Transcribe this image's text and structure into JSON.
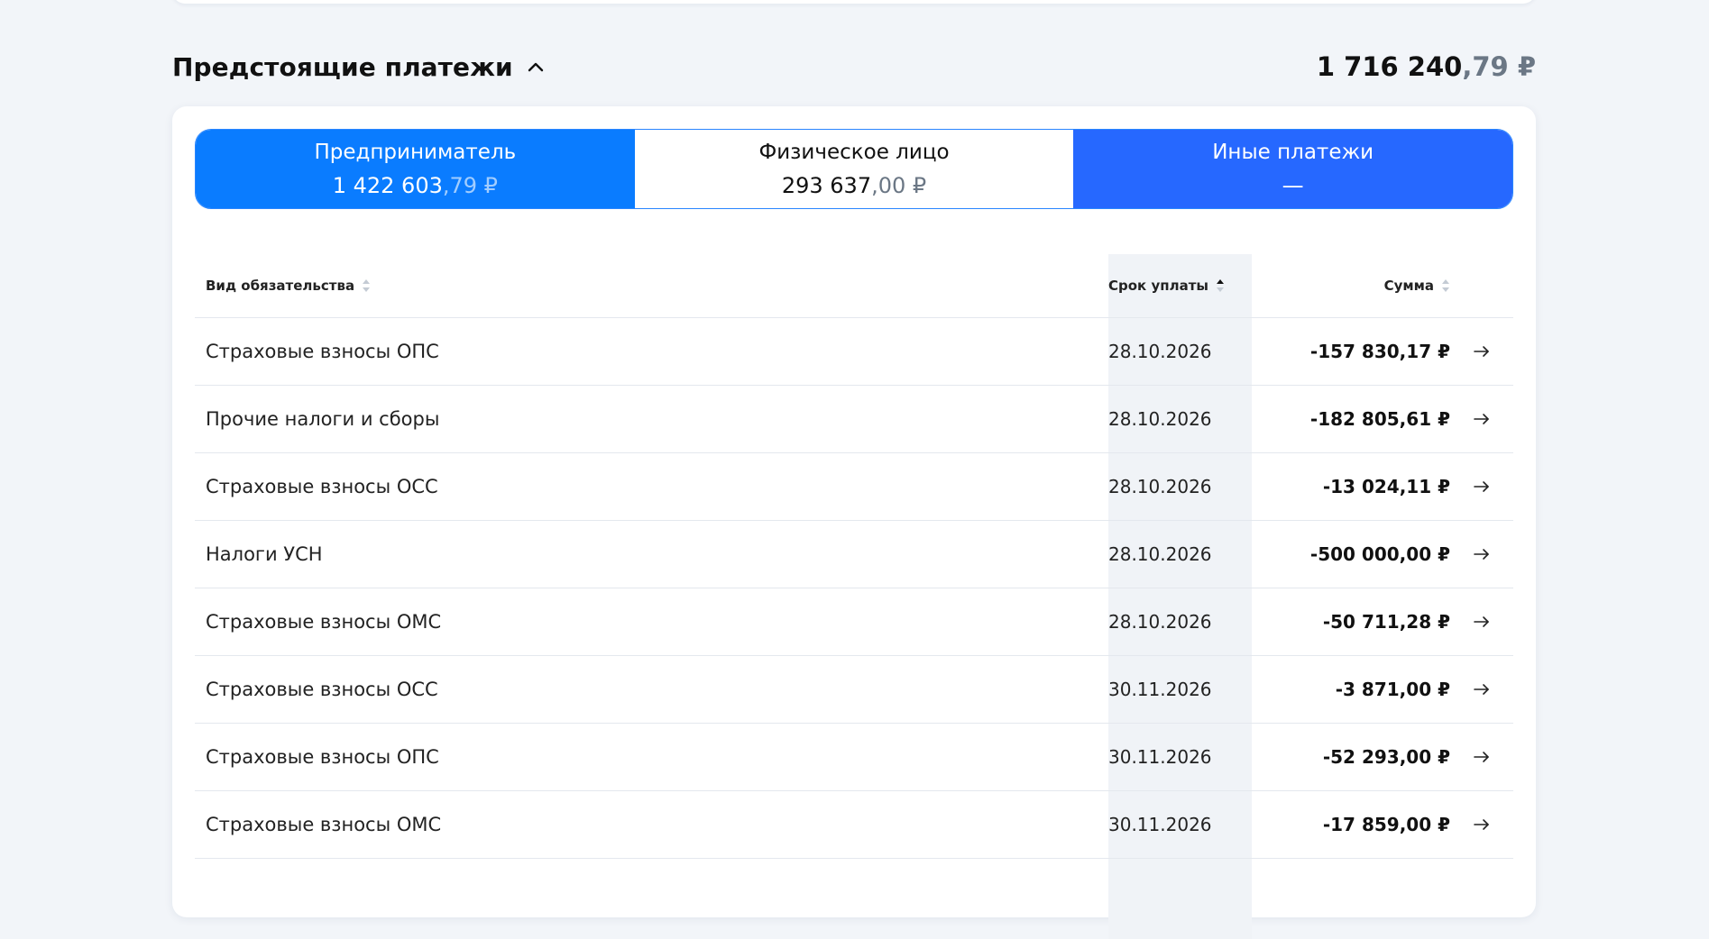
{
  "section": {
    "title": "Предстоящие платежи",
    "total_int": "1 716 240",
    "total_frac": ",79 ₽"
  },
  "tabs": [
    {
      "label": "Предприниматель",
      "amount_int": "1 422 603",
      "amount_frac": ",79 ₽"
    },
    {
      "label": "Физическое лицо",
      "amount_int": "293 637",
      "amount_frac": ",00 ₽"
    },
    {
      "label": "Иные платежи",
      "amount_int": "—",
      "amount_frac": ""
    }
  ],
  "table": {
    "headers": {
      "type": "Вид обязательства",
      "date": "Срок уплаты",
      "sum": "Сумма"
    },
    "rows": [
      {
        "type": "Страховые взносы ОПС",
        "date": "28.10.2026",
        "sum": "-157 830,17 ₽"
      },
      {
        "type": "Прочие налоги и сборы",
        "date": "28.10.2026",
        "sum": "-182 805,61 ₽"
      },
      {
        "type": "Страховые взносы ОСС",
        "date": "28.10.2026",
        "sum": "-13 024,11 ₽"
      },
      {
        "type": "Налоги УСН",
        "date": "28.10.2026",
        "sum": "-500 000,00 ₽"
      },
      {
        "type": "Страховые взносы ОМС",
        "date": "28.10.2026",
        "sum": "-50 711,28 ₽"
      },
      {
        "type": "Страховые взносы ОСС",
        "date": "30.11.2026",
        "sum": "-3 871,00 ₽"
      },
      {
        "type": "Страховые взносы ОПС",
        "date": "30.11.2026",
        "sum": "-52 293,00 ₽"
      },
      {
        "type": "Страховые взносы ОМС",
        "date": "30.11.2026",
        "sum": "-17 859,00 ₽"
      }
    ]
  },
  "icons": {
    "collapse": "chevron-up-icon",
    "sort_neutral": "sort-neutral-icon",
    "sort_active": "sort-ascending-icon",
    "row_action": "arrow-right-icon"
  },
  "colors": {
    "tab_primary": "#0a7cff",
    "tab_other": "#2668ff",
    "tab_border": "#2a86ff",
    "page_bg": "#f2f5f9"
  }
}
